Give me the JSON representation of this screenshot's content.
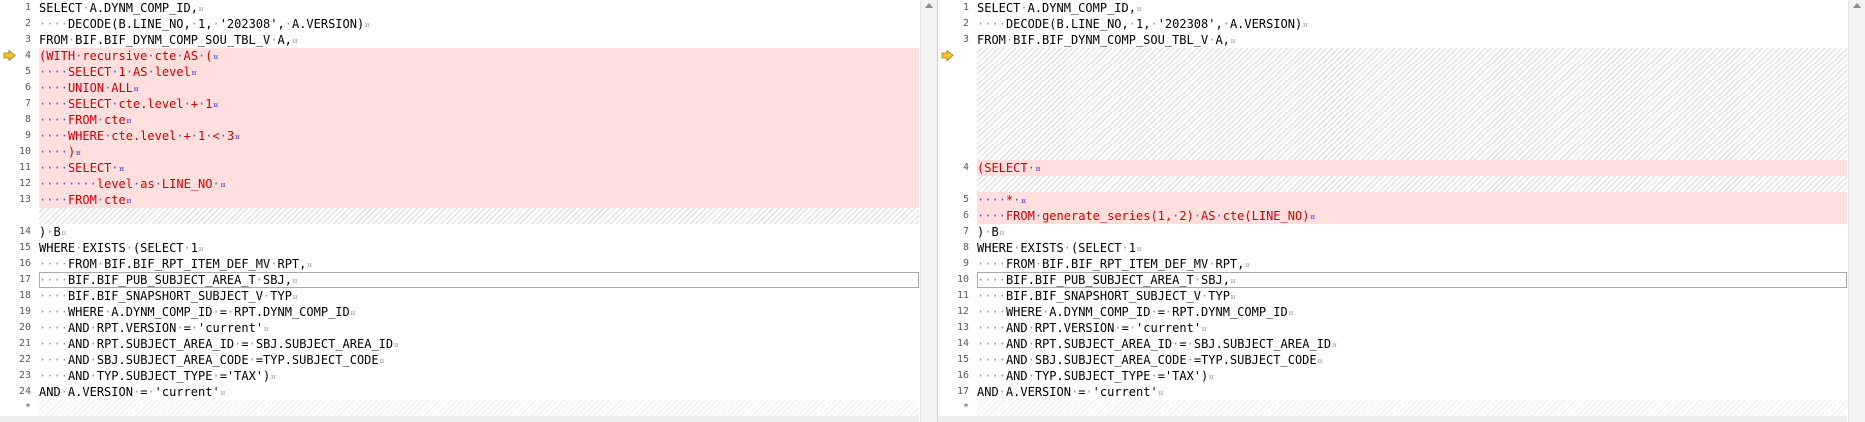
{
  "left": {
    "lines": [
      {
        "n": "1",
        "t": "SELECT A.DYNM_COMP_ID,"
      },
      {
        "n": "2",
        "t": "    DECODE(B.LINE_NO, 1, '202308', A.VERSION)"
      },
      {
        "n": "3",
        "t": "FROM BIF.BIF_DYNM_COMP_SOU_TBL_V A,"
      },
      {
        "n": "4",
        "t": "(WITH recursive cte AS (",
        "c": true,
        "marker": true
      },
      {
        "n": "5",
        "t": "    SELECT 1 AS level",
        "c": true
      },
      {
        "n": "6",
        "t": "    UNION ALL",
        "c": true
      },
      {
        "n": "7",
        "t": "    SELECT cte.level + 1",
        "c": true
      },
      {
        "n": "8",
        "t": "    FROM cte",
        "c": true
      },
      {
        "n": "9",
        "t": "    WHERE cte.level + 1 < 3",
        "c": true
      },
      {
        "n": "10",
        "t": "    )",
        "c": true
      },
      {
        "n": "11",
        "t": "    SELECT ",
        "c": true
      },
      {
        "n": "12",
        "t": "        level as LINE_NO ",
        "c": true
      },
      {
        "n": "13",
        "t": "    FROM cte",
        "c": true
      },
      {
        "n": "",
        "t": "",
        "gap": true
      },
      {
        "n": "14",
        "t": ") B"
      },
      {
        "n": "15",
        "t": "WHERE EXISTS (SELECT 1"
      },
      {
        "n": "16",
        "t": "    FROM BIF.BIF_RPT_ITEM_DEF_MV RPT,"
      },
      {
        "n": "17",
        "t": "    BIF.BIF_PUB_SUBJECT_AREA_T SBJ,",
        "cursor": true
      },
      {
        "n": "18",
        "t": "    BIF.BIF_SNAPSHORT_SUBJECT_V TYP"
      },
      {
        "n": "19",
        "t": "    WHERE A.DYNM_COMP_ID = RPT.DYNM_COMP_ID"
      },
      {
        "n": "20",
        "t": "    AND RPT.VERSION = 'current'"
      },
      {
        "n": "21",
        "t": "    AND RPT.SUBJECT_AREA_ID = SBJ.SUBJECT_AREA_ID"
      },
      {
        "n": "22",
        "t": "    AND SBJ.SUBJECT_AREA_CODE =TYP.SUBJECT_CODE"
      },
      {
        "n": "23",
        "t": "    AND TYP.SUBJECT_TYPE ='TAX')"
      },
      {
        "n": "24",
        "t": "AND A.VERSION = 'current'"
      },
      {
        "n": "*",
        "t": "",
        "end": true
      }
    ]
  },
  "right": {
    "lines": [
      {
        "n": "1",
        "t": "SELECT A.DYNM_COMP_ID,"
      },
      {
        "n": "2",
        "t": "    DECODE(B.LINE_NO, 1, '202308', A.VERSION)"
      },
      {
        "n": "3",
        "t": "FROM BIF.BIF_DYNM_COMP_SOU_TBL_V A,"
      },
      {
        "n": "",
        "t": "",
        "gap": true,
        "marker": true
      },
      {
        "n": "",
        "t": "",
        "gap": true
      },
      {
        "n": "",
        "t": "",
        "gap": true
      },
      {
        "n": "",
        "t": "",
        "gap": true
      },
      {
        "n": "",
        "t": "",
        "gap": true
      },
      {
        "n": "",
        "t": "",
        "gap": true
      },
      {
        "n": "",
        "t": "",
        "gap": true
      },
      {
        "n": "4",
        "t": "(SELECT ",
        "c": true
      },
      {
        "n": "",
        "t": "",
        "gap": true
      },
      {
        "n": "5",
        "t": "    * ",
        "c": true
      },
      {
        "n": "6",
        "t": "    FROM generate_series(1, 2) AS cte(LINE_NO)",
        "c": true
      },
      {
        "n": "7",
        "t": ") B"
      },
      {
        "n": "8",
        "t": "WHERE EXISTS (SELECT 1"
      },
      {
        "n": "9",
        "t": "    FROM BIF.BIF_RPT_ITEM_DEF_MV RPT,"
      },
      {
        "n": "10",
        "t": "    BIF.BIF_PUB_SUBJECT_AREA_T SBJ,",
        "cursor": true
      },
      {
        "n": "11",
        "t": "    BIF.BIF_SNAPSHORT_SUBJECT_V TYP"
      },
      {
        "n": "12",
        "t": "    WHERE A.DYNM_COMP_ID = RPT.DYNM_COMP_ID"
      },
      {
        "n": "13",
        "t": "    AND RPT.VERSION = 'current'"
      },
      {
        "n": "14",
        "t": "    AND RPT.SUBJECT_AREA_ID = SBJ.SUBJECT_AREA_ID"
      },
      {
        "n": "15",
        "t": "    AND SBJ.SUBJECT_AREA_CODE =TYP.SUBJECT_CODE"
      },
      {
        "n": "16",
        "t": "    AND TYP.SUBJECT_TYPE ='TAX')"
      },
      {
        "n": "17",
        "t": "AND A.VERSION = 'current'"
      },
      {
        "n": "*",
        "t": "",
        "end": true
      }
    ]
  },
  "colors": {
    "changed_bg": "#ffdede",
    "changed_text": "#d00000",
    "marker": "#f2c230"
  }
}
